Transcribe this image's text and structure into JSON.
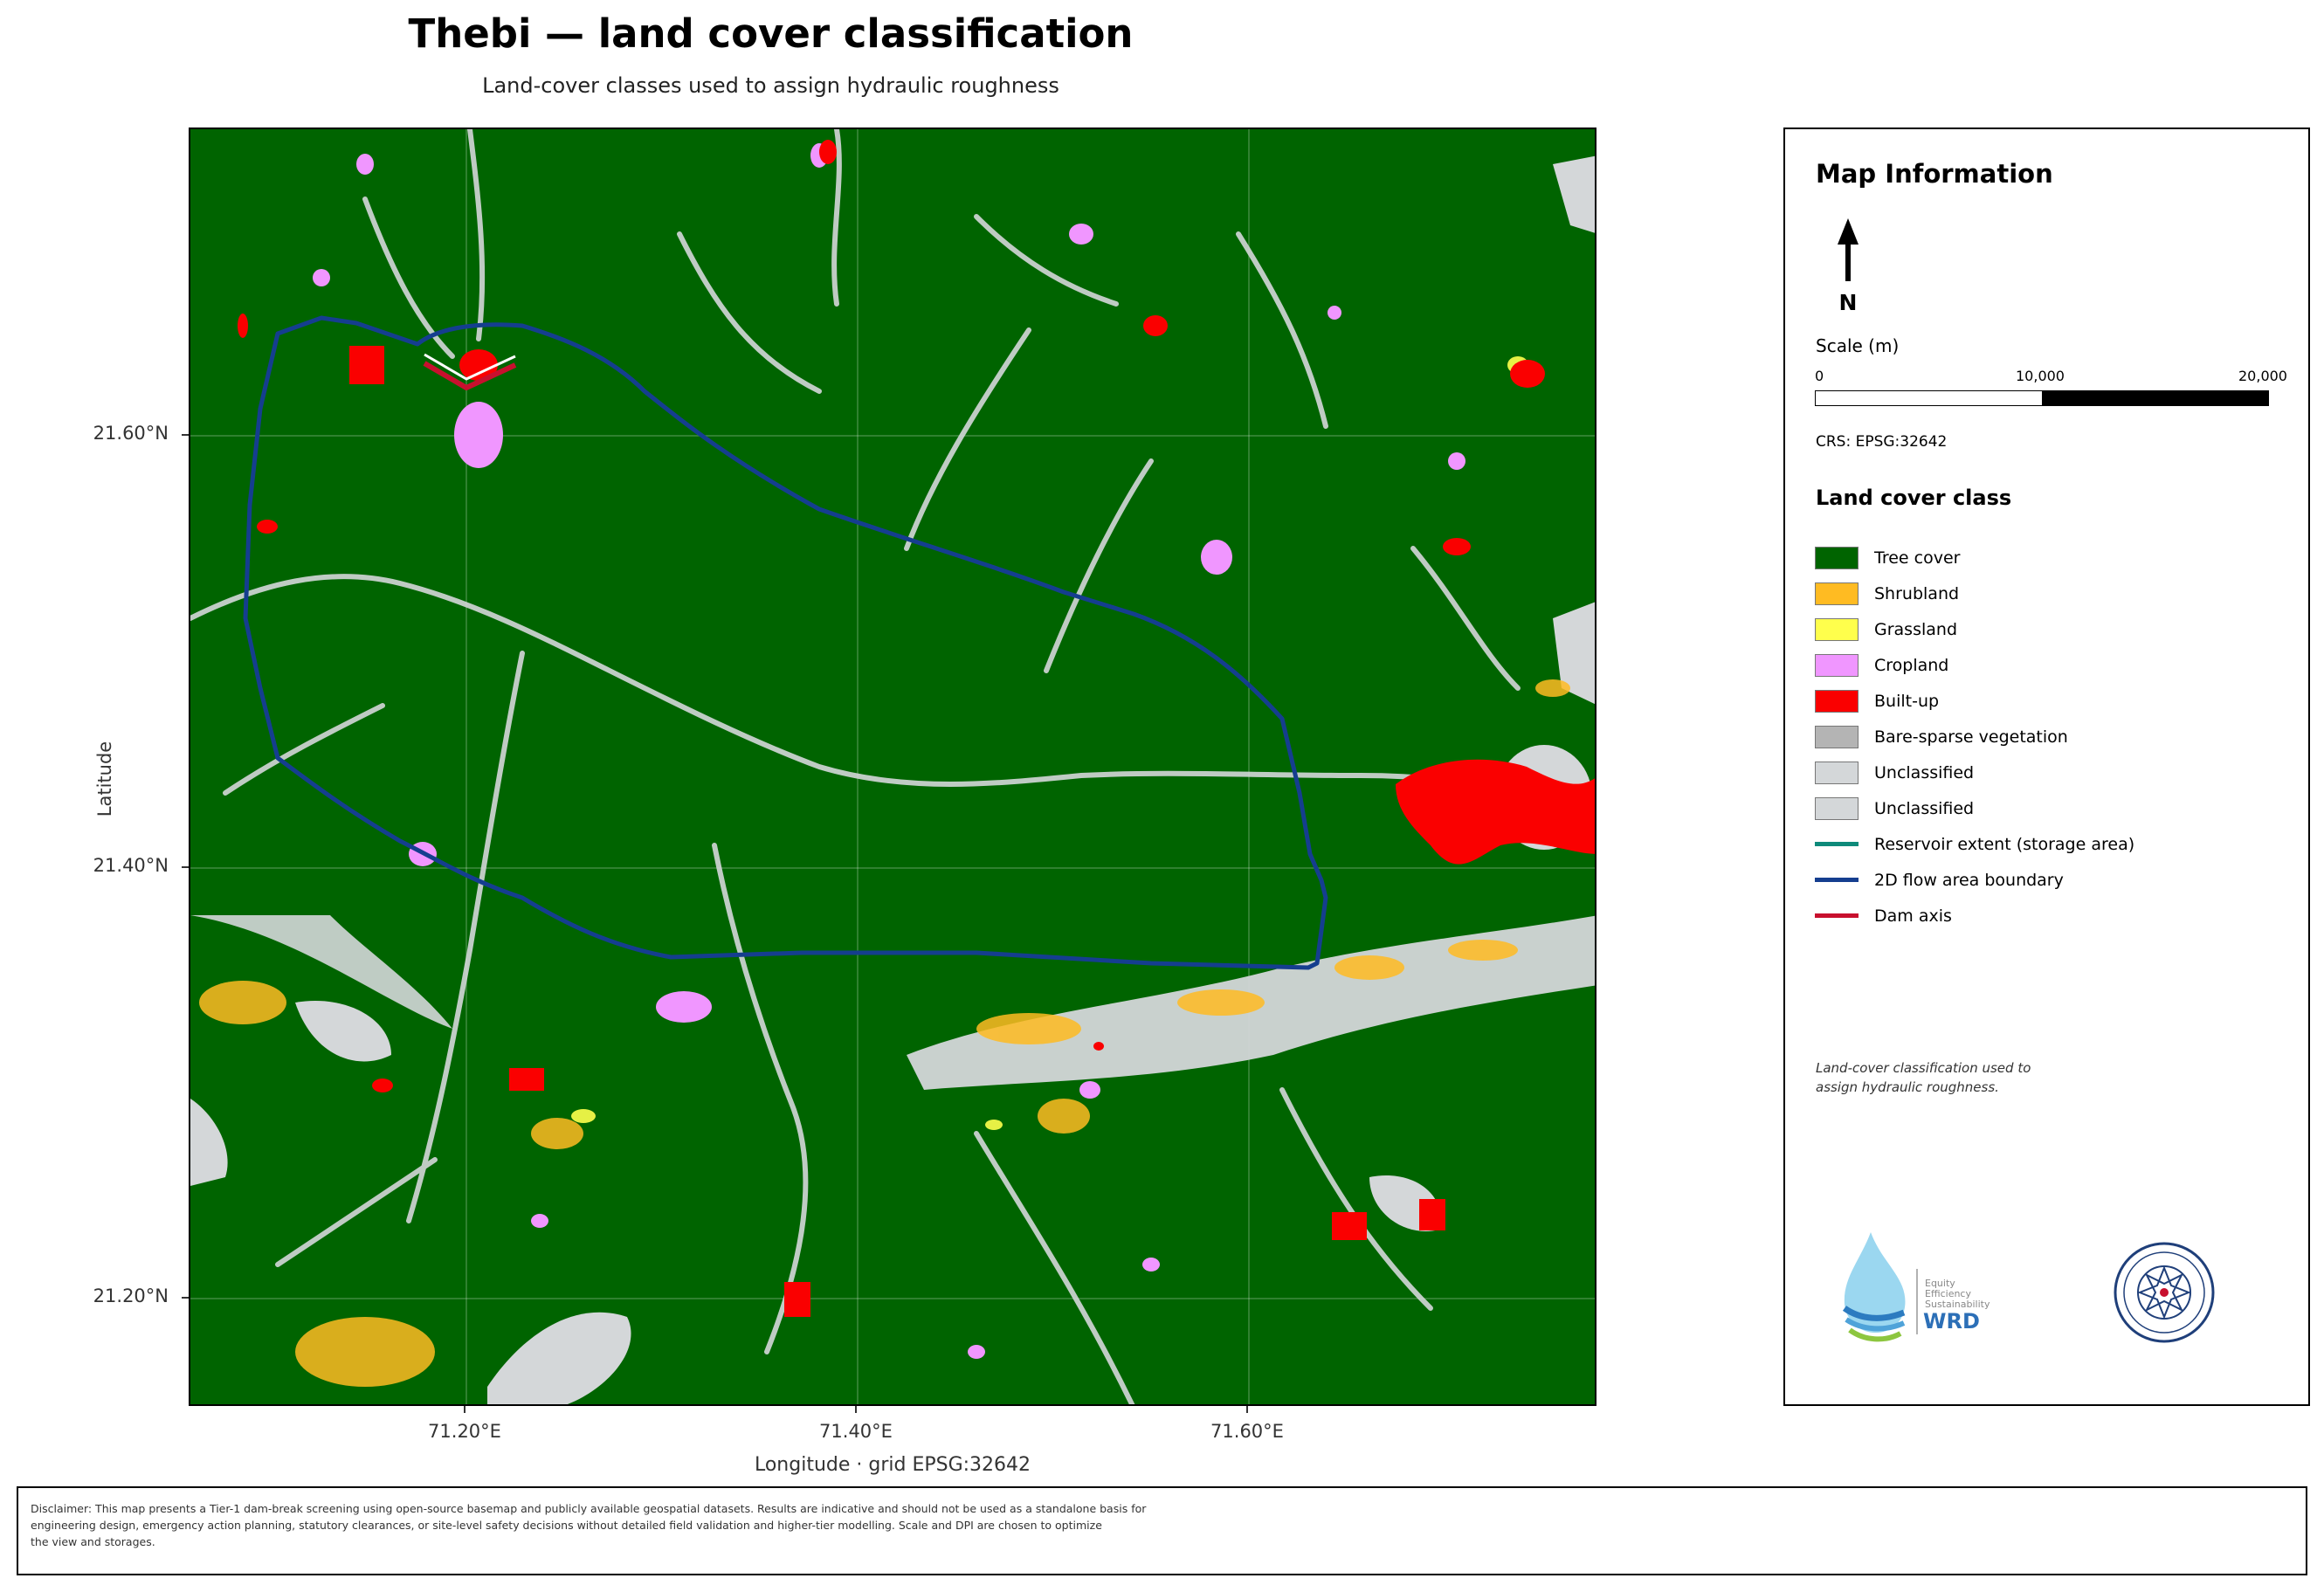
{
  "title": "Thebi — land cover classification",
  "subtitle": "Land-cover classes used to assign hydraulic roughness",
  "axes": {
    "xlabel": "Longitude   ·   grid EPSG:32642",
    "ylabel": "Latitude",
    "xticks": [
      "71.20°E",
      "71.40°E",
      "71.60°E"
    ],
    "yticks": [
      "21.60°N",
      "21.40°N",
      "21.20°N"
    ]
  },
  "panel": {
    "title": "Map Information",
    "north_label": "N",
    "scale_title": "Scale (m)",
    "scale_values": [
      "0",
      "10,000",
      "20,000"
    ],
    "crs": "CRS: EPSG:32642",
    "legend_title": "Land cover class",
    "legend": [
      {
        "label": "Tree cover",
        "color": "#006400",
        "kind": "patch"
      },
      {
        "label": "Shrubland",
        "color": "#FFBB22",
        "kind": "patch"
      },
      {
        "label": "Grassland",
        "color": "#FFFF4C",
        "kind": "patch"
      },
      {
        "label": "Cropland",
        "color": "#F096FF",
        "kind": "patch"
      },
      {
        "label": "Built-up",
        "color": "#FA0000",
        "kind": "patch"
      },
      {
        "label": "Bare-sparse vegetation",
        "color": "#B4B4B4",
        "kind": "patch"
      },
      {
        "label": "Unclassified",
        "color": "#D4D7D9",
        "kind": "patch"
      },
      {
        "label": "Unclassified",
        "color": "#D4D7D9",
        "kind": "patch"
      },
      {
        "label": "Reservoir extent (storage area)",
        "color": "#0E8A7A",
        "kind": "line"
      },
      {
        "label": "2D flow area boundary",
        "color": "#153E8F",
        "kind": "line"
      },
      {
        "label": "Dam axis",
        "color": "#C8102E",
        "kind": "line"
      }
    ],
    "note_lines": [
      "Land-cover classification used to",
      "assign hydraulic roughness."
    ],
    "logo_text": [
      "Equity",
      "Efficiency",
      "Sustainability",
      "WRD"
    ]
  },
  "disclaimer": [
    "Disclaimer: This map presents a Tier-1 dam-break screening using open-source basemap and publicly available geospatial datasets. Results are indicative and should not be used as a standalone basis for",
    "engineering design, emergency action planning, statutory clearances, or site-level safety decisions without detailed field validation and higher-tier modelling. Scale and DPI are chosen to optimize",
    "the view and storages."
  ]
}
